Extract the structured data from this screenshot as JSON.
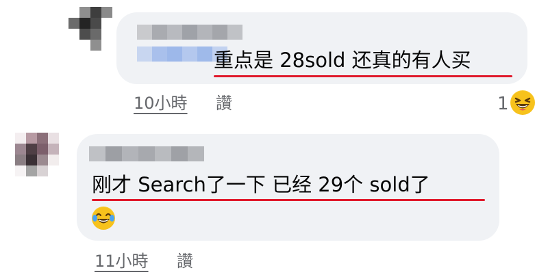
{
  "comments": [
    {
      "text": "重点是 28sold 还真的有人买",
      "time": "10小時",
      "like_label": "讚",
      "reaction_count": "1",
      "reaction_icon": "laughing-emoji-icon"
    },
    {
      "text": "刚才 Search了一下 已经 29个 sold了",
      "time": "11小時",
      "like_label": "讚",
      "inline_emoji": "tears-of-joy-emoji-icon"
    }
  ],
  "colors": {
    "bubble": "#f0f2f5",
    "underline": "#e0192b",
    "meta_text": "#65676b"
  }
}
